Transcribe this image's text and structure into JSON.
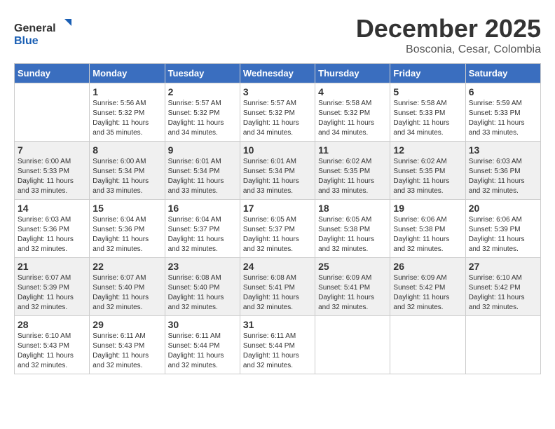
{
  "header": {
    "logo_line1": "General",
    "logo_line2": "Blue",
    "title": "December 2025",
    "subtitle": "Bosconia, Cesar, Colombia"
  },
  "weekdays": [
    "Sunday",
    "Monday",
    "Tuesday",
    "Wednesday",
    "Thursday",
    "Friday",
    "Saturday"
  ],
  "weeks": [
    [
      {
        "day": "",
        "sunrise": "",
        "sunset": "",
        "daylight": ""
      },
      {
        "day": "1",
        "sunrise": "Sunrise: 5:56 AM",
        "sunset": "Sunset: 5:32 PM",
        "daylight": "Daylight: 11 hours and 35 minutes."
      },
      {
        "day": "2",
        "sunrise": "Sunrise: 5:57 AM",
        "sunset": "Sunset: 5:32 PM",
        "daylight": "Daylight: 11 hours and 34 minutes."
      },
      {
        "day": "3",
        "sunrise": "Sunrise: 5:57 AM",
        "sunset": "Sunset: 5:32 PM",
        "daylight": "Daylight: 11 hours and 34 minutes."
      },
      {
        "day": "4",
        "sunrise": "Sunrise: 5:58 AM",
        "sunset": "Sunset: 5:32 PM",
        "daylight": "Daylight: 11 hours and 34 minutes."
      },
      {
        "day": "5",
        "sunrise": "Sunrise: 5:58 AM",
        "sunset": "Sunset: 5:33 PM",
        "daylight": "Daylight: 11 hours and 34 minutes."
      },
      {
        "day": "6",
        "sunrise": "Sunrise: 5:59 AM",
        "sunset": "Sunset: 5:33 PM",
        "daylight": "Daylight: 11 hours and 33 minutes."
      }
    ],
    [
      {
        "day": "7",
        "sunrise": "Sunrise: 6:00 AM",
        "sunset": "Sunset: 5:33 PM",
        "daylight": "Daylight: 11 hours and 33 minutes."
      },
      {
        "day": "8",
        "sunrise": "Sunrise: 6:00 AM",
        "sunset": "Sunset: 5:34 PM",
        "daylight": "Daylight: 11 hours and 33 minutes."
      },
      {
        "day": "9",
        "sunrise": "Sunrise: 6:01 AM",
        "sunset": "Sunset: 5:34 PM",
        "daylight": "Daylight: 11 hours and 33 minutes."
      },
      {
        "day": "10",
        "sunrise": "Sunrise: 6:01 AM",
        "sunset": "Sunset: 5:34 PM",
        "daylight": "Daylight: 11 hours and 33 minutes."
      },
      {
        "day": "11",
        "sunrise": "Sunrise: 6:02 AM",
        "sunset": "Sunset: 5:35 PM",
        "daylight": "Daylight: 11 hours and 33 minutes."
      },
      {
        "day": "12",
        "sunrise": "Sunrise: 6:02 AM",
        "sunset": "Sunset: 5:35 PM",
        "daylight": "Daylight: 11 hours and 33 minutes."
      },
      {
        "day": "13",
        "sunrise": "Sunrise: 6:03 AM",
        "sunset": "Sunset: 5:36 PM",
        "daylight": "Daylight: 11 hours and 32 minutes."
      }
    ],
    [
      {
        "day": "14",
        "sunrise": "Sunrise: 6:03 AM",
        "sunset": "Sunset: 5:36 PM",
        "daylight": "Daylight: 11 hours and 32 minutes."
      },
      {
        "day": "15",
        "sunrise": "Sunrise: 6:04 AM",
        "sunset": "Sunset: 5:36 PM",
        "daylight": "Daylight: 11 hours and 32 minutes."
      },
      {
        "day": "16",
        "sunrise": "Sunrise: 6:04 AM",
        "sunset": "Sunset: 5:37 PM",
        "daylight": "Daylight: 11 hours and 32 minutes."
      },
      {
        "day": "17",
        "sunrise": "Sunrise: 6:05 AM",
        "sunset": "Sunset: 5:37 PM",
        "daylight": "Daylight: 11 hours and 32 minutes."
      },
      {
        "day": "18",
        "sunrise": "Sunrise: 6:05 AM",
        "sunset": "Sunset: 5:38 PM",
        "daylight": "Daylight: 11 hours and 32 minutes."
      },
      {
        "day": "19",
        "sunrise": "Sunrise: 6:06 AM",
        "sunset": "Sunset: 5:38 PM",
        "daylight": "Daylight: 11 hours and 32 minutes."
      },
      {
        "day": "20",
        "sunrise": "Sunrise: 6:06 AM",
        "sunset": "Sunset: 5:39 PM",
        "daylight": "Daylight: 11 hours and 32 minutes."
      }
    ],
    [
      {
        "day": "21",
        "sunrise": "Sunrise: 6:07 AM",
        "sunset": "Sunset: 5:39 PM",
        "daylight": "Daylight: 11 hours and 32 minutes."
      },
      {
        "day": "22",
        "sunrise": "Sunrise: 6:07 AM",
        "sunset": "Sunset: 5:40 PM",
        "daylight": "Daylight: 11 hours and 32 minutes."
      },
      {
        "day": "23",
        "sunrise": "Sunrise: 6:08 AM",
        "sunset": "Sunset: 5:40 PM",
        "daylight": "Daylight: 11 hours and 32 minutes."
      },
      {
        "day": "24",
        "sunrise": "Sunrise: 6:08 AM",
        "sunset": "Sunset: 5:41 PM",
        "daylight": "Daylight: 11 hours and 32 minutes."
      },
      {
        "day": "25",
        "sunrise": "Sunrise: 6:09 AM",
        "sunset": "Sunset: 5:41 PM",
        "daylight": "Daylight: 11 hours and 32 minutes."
      },
      {
        "day": "26",
        "sunrise": "Sunrise: 6:09 AM",
        "sunset": "Sunset: 5:42 PM",
        "daylight": "Daylight: 11 hours and 32 minutes."
      },
      {
        "day": "27",
        "sunrise": "Sunrise: 6:10 AM",
        "sunset": "Sunset: 5:42 PM",
        "daylight": "Daylight: 11 hours and 32 minutes."
      }
    ],
    [
      {
        "day": "28",
        "sunrise": "Sunrise: 6:10 AM",
        "sunset": "Sunset: 5:43 PM",
        "daylight": "Daylight: 11 hours and 32 minutes."
      },
      {
        "day": "29",
        "sunrise": "Sunrise: 6:11 AM",
        "sunset": "Sunset: 5:43 PM",
        "daylight": "Daylight: 11 hours and 32 minutes."
      },
      {
        "day": "30",
        "sunrise": "Sunrise: 6:11 AM",
        "sunset": "Sunset: 5:44 PM",
        "daylight": "Daylight: 11 hours and 32 minutes."
      },
      {
        "day": "31",
        "sunrise": "Sunrise: 6:11 AM",
        "sunset": "Sunset: 5:44 PM",
        "daylight": "Daylight: 11 hours and 32 minutes."
      },
      {
        "day": "",
        "sunrise": "",
        "sunset": "",
        "daylight": ""
      },
      {
        "day": "",
        "sunrise": "",
        "sunset": "",
        "daylight": ""
      },
      {
        "day": "",
        "sunrise": "",
        "sunset": "",
        "daylight": ""
      }
    ]
  ]
}
